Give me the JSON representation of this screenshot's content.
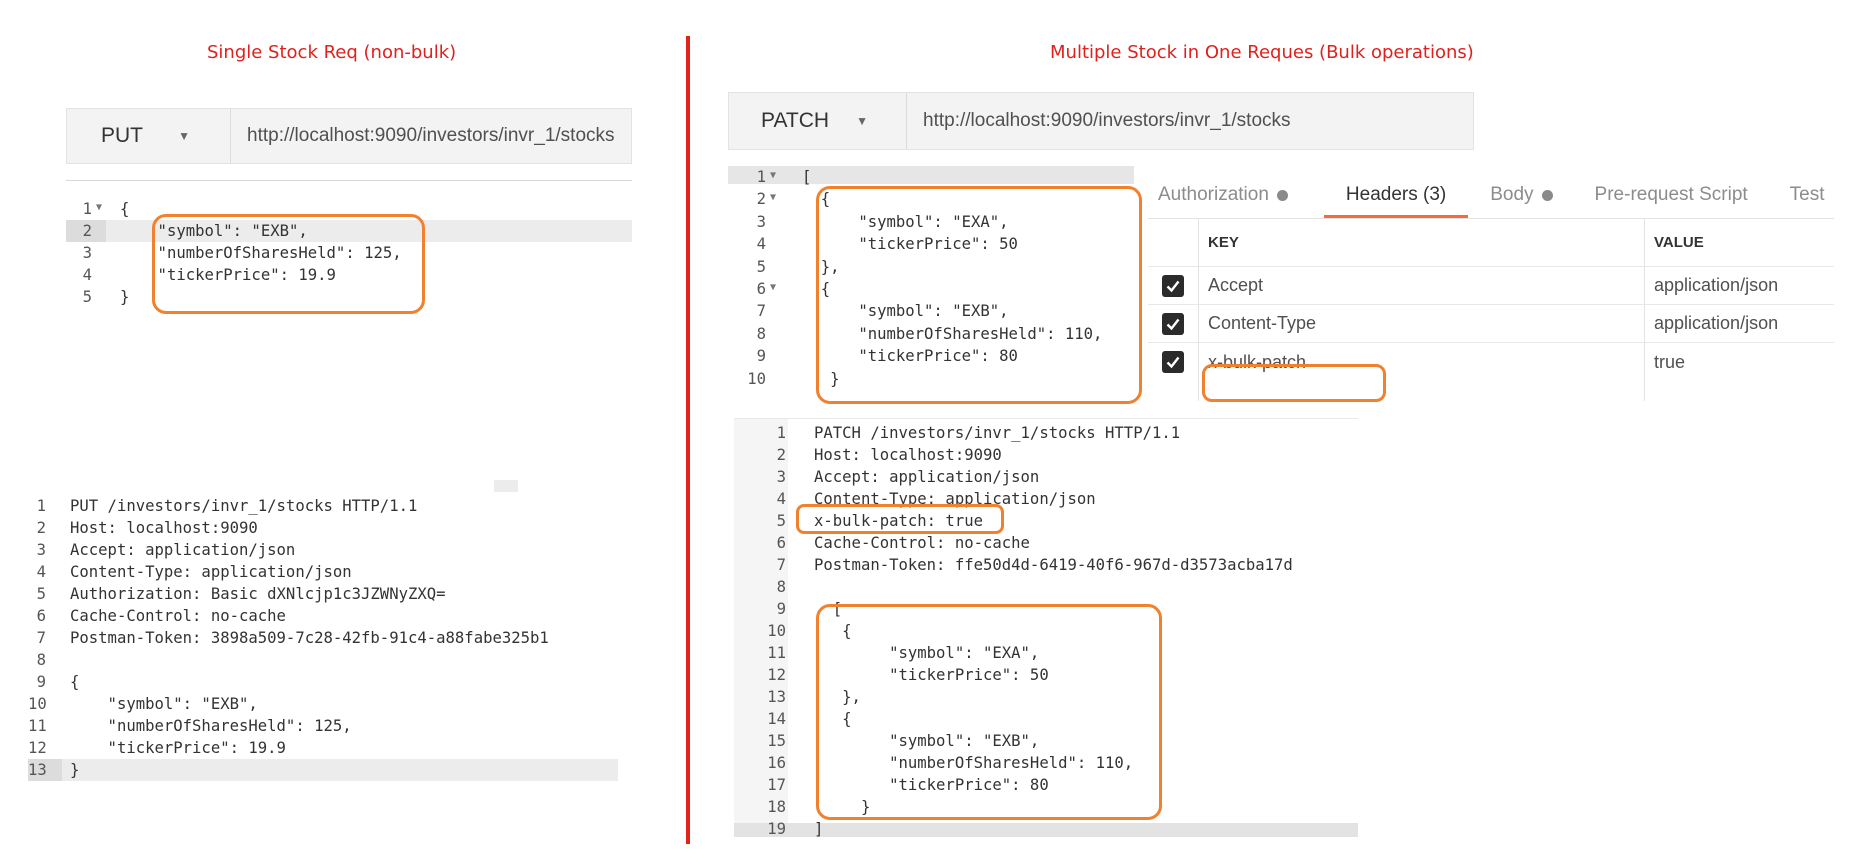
{
  "titles": {
    "left": "Single Stock Req (non-bulk)",
    "right": "Multiple Stock in One Reques (Bulk operations)"
  },
  "put_request": {
    "method": "PUT",
    "url": "http://localhost:9090/investors/invr_1/stocks",
    "body_lines": [
      "{",
      "    \"symbol\": \"EXB\",",
      "    \"numberOfSharesHeld\": 125,",
      "    \"tickerPrice\": 19.9",
      "}"
    ],
    "body_line_numbers": [
      "1",
      "2",
      "3",
      "4",
      "5"
    ],
    "raw_lines": [
      "PUT /investors/invr_1/stocks HTTP/1.1",
      "Host: localhost:9090",
      "Accept: application/json",
      "Content-Type: application/json",
      "Authorization: Basic dXNlcjp1c3JZWNyZXQ=",
      "Cache-Control: no-cache",
      "Postman-Token: 3898a509-7c28-42fb-91c4-a88fabe325b1",
      "",
      "{",
      "    \"symbol\": \"EXB\",",
      "    \"numberOfSharesHeld\": 125,",
      "    \"tickerPrice\": 19.9",
      "}"
    ],
    "raw_line_numbers": [
      "1",
      "2",
      "3",
      "4",
      "5",
      "6",
      "7",
      "8",
      "9",
      "10",
      "11",
      "12",
      "13"
    ]
  },
  "patch_request": {
    "method": "PATCH",
    "url": "http://localhost:9090/investors/invr_1/stocks",
    "body_lines": [
      "[",
      "  {",
      "      \"symbol\": \"EXA\",",
      "      \"tickerPrice\": 50",
      "  },",
      "  {",
      "      \"symbol\": \"EXB\",",
      "      \"numberOfSharesHeld\": 110,",
      "      \"tickerPrice\": 80",
      "   }"
    ],
    "body_line_numbers": [
      "1",
      "2",
      "3",
      "4",
      "5",
      "6",
      "7",
      "8",
      "9",
      "10"
    ],
    "tabs": [
      {
        "label": "Authorization",
        "dot": true
      },
      {
        "label": "Headers (3)",
        "dot": false
      },
      {
        "label": "Body",
        "dot": true
      },
      {
        "label": "Pre-request Script",
        "dot": false
      },
      {
        "label": "Test",
        "dot": false
      }
    ],
    "headers_table": {
      "key_col": "KEY",
      "value_col": "VALUE",
      "rows": [
        {
          "key": "Accept",
          "value": "application/json",
          "checked": true
        },
        {
          "key": "Content-Type",
          "value": "application/json",
          "checked": true
        },
        {
          "key": "x-bulk-patch",
          "value": "true",
          "checked": true
        }
      ]
    },
    "raw_lines": [
      "PATCH /investors/invr_1/stocks HTTP/1.1",
      "Host: localhost:9090",
      "Accept: application/json",
      "Content-Type: application/json",
      "x-bulk-patch: true",
      "Cache-Control: no-cache",
      "Postman-Token: ffe50d4d-6419-40f6-967d-d3573acba17d",
      "",
      "  [",
      "   {",
      "        \"symbol\": \"EXA\",",
      "        \"tickerPrice\": 50",
      "   },",
      "   {",
      "        \"symbol\": \"EXB\",",
      "        \"numberOfSharesHeld\": 110,",
      "        \"tickerPrice\": 80",
      "     }",
      "]"
    ],
    "raw_line_numbers": [
      "1",
      "2",
      "3",
      "4",
      "5",
      "6",
      "7",
      "8",
      "9",
      "10",
      "11",
      "12",
      "13",
      "14",
      "15",
      "16",
      "17",
      "18",
      "19"
    ]
  },
  "colors": {
    "title_red": "#e0201c",
    "divider_red": "#e2231a",
    "highlight_orange": "#f0822f",
    "active_tab_underline": "#f26b3a"
  }
}
